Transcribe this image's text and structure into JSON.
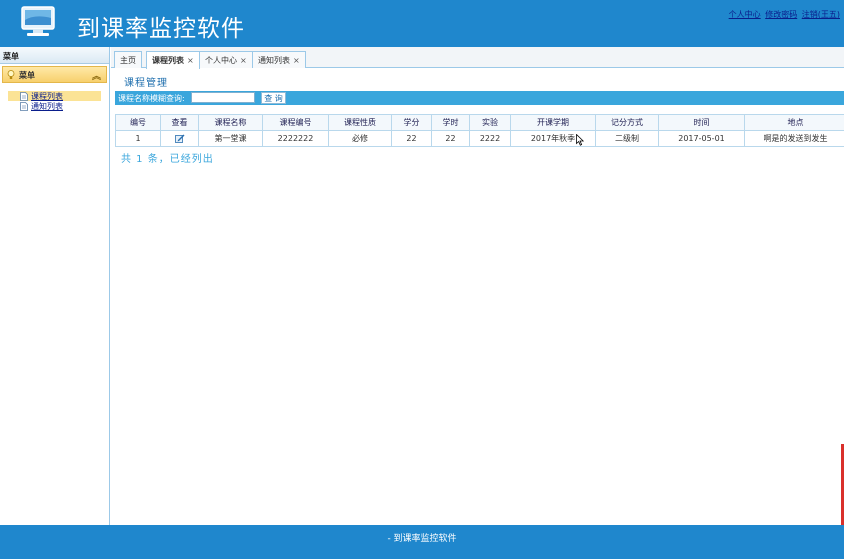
{
  "app": {
    "title": "到课率监控软件",
    "top_links": [
      "个人中心",
      "修改密码",
      "注销(王五)"
    ]
  },
  "sidebar": {
    "header": "菜单",
    "panel_title": "菜单",
    "items": [
      {
        "label": "课程列表",
        "icon": "document-icon",
        "active": true
      },
      {
        "label": "通知列表",
        "icon": "document-icon",
        "active": false
      }
    ]
  },
  "tabs": [
    {
      "label": "主页",
      "closable": false,
      "active": false
    },
    {
      "label": "课程列表",
      "closable": true,
      "active": true
    },
    {
      "label": "个人中心",
      "closable": true,
      "active": false
    },
    {
      "label": "通知列表",
      "closable": true,
      "active": false
    }
  ],
  "tab_close_glyph": "×",
  "content": {
    "section_title": "课程管理",
    "search": {
      "label": "课程名称模糊查询:",
      "value": "",
      "button_label": "查 询"
    },
    "table": {
      "columns": [
        "编号",
        "查看",
        "课程名称",
        "课程编号",
        "课程性质",
        "学分",
        "学时",
        "实验",
        "开课学期",
        "记分方式",
        "时间",
        "地点"
      ],
      "rows": [
        [
          "1",
          "",
          "第一堂课",
          "2222222",
          "必修",
          "22",
          "22",
          "2222",
          "2017年秋季",
          "二级制",
          "2017-05-01",
          "啊是的发送到发生"
        ]
      ]
    },
    "summary": "共 1 条，已经列出"
  },
  "footer": {
    "text": "- 到课率监控软件"
  },
  "colors": {
    "header_bg": "#1f87cd",
    "search_bar_bg": "#3aa6dc",
    "menu_highlight": "#fbe396"
  }
}
